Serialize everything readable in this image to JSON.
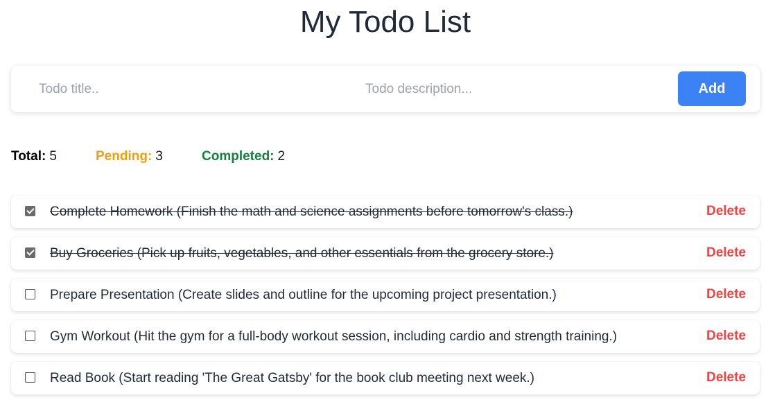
{
  "title": "My Todo List",
  "form": {
    "title_placeholder": "Todo title..",
    "description_placeholder": "Todo description...",
    "title_value": "",
    "description_value": "",
    "add_label": "Add"
  },
  "stats": {
    "total_label": "Total:",
    "total": "5",
    "pending_label": "Pending:",
    "pending": "3",
    "completed_label": "Completed:",
    "completed": "2",
    "colors": {
      "pending": "#f59e0b",
      "completed": "#15803d"
    }
  },
  "todos": [
    {
      "text": "Complete Homework (Finish the math and science assignments before tomorrow's class.)",
      "completed": true,
      "delete_label": "Delete"
    },
    {
      "text": "Buy Groceries (Pick up fruits, vegetables, and other essentials from the grocery store.)",
      "completed": true,
      "delete_label": "Delete"
    },
    {
      "text": "Prepare Presentation (Create slides and outline for the upcoming project presentation.)",
      "completed": false,
      "delete_label": "Delete"
    },
    {
      "text": "Gym Workout (Hit the gym for a full-body workout session, including cardio and strength training.)",
      "completed": false,
      "delete_label": "Delete"
    },
    {
      "text": "Read Book (Start reading 'The Great Gatsby' for the book club meeting next week.)",
      "completed": false,
      "delete_label": "Delete"
    }
  ],
  "colors": {
    "accent": "#3b82f6",
    "delete": "#ef4444"
  }
}
